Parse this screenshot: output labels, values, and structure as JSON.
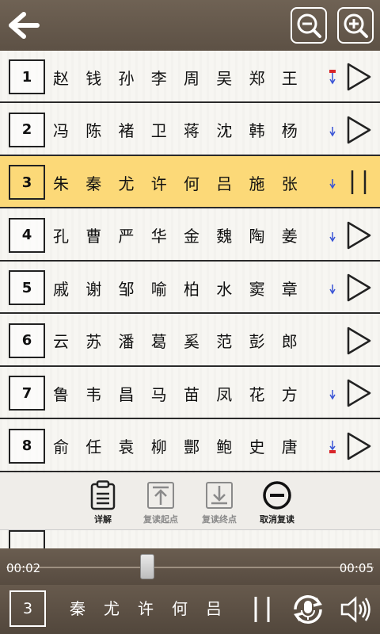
{
  "toolbar": {
    "back_icon": "back-arrow-icon",
    "zoom_out_icon": "zoom-out-icon",
    "zoom_in_icon": "zoom-in-icon"
  },
  "rows": [
    {
      "num": "1",
      "names": [
        "赵",
        "钱",
        "孙",
        "李",
        "周",
        "吴",
        "郑",
        "王"
      ],
      "indicator": "down-arrow-red",
      "state": "play"
    },
    {
      "num": "2",
      "names": [
        "冯",
        "陈",
        "褚",
        "卫",
        "蒋",
        "沈",
        "韩",
        "杨"
      ],
      "indicator": "down-arrow-blue",
      "state": "play"
    },
    {
      "num": "3",
      "names": [
        "朱",
        "秦",
        "尤",
        "许",
        "何",
        "吕",
        "施",
        "张"
      ],
      "indicator": "down-arrow-blue",
      "state": "pause"
    },
    {
      "num": "4",
      "names": [
        "孔",
        "曹",
        "严",
        "华",
        "金",
        "魏",
        "陶",
        "姜"
      ],
      "indicator": "down-arrow-blue",
      "state": "play"
    },
    {
      "num": "5",
      "names": [
        "戚",
        "谢",
        "邹",
        "喻",
        "柏",
        "水",
        "窦",
        "章"
      ],
      "indicator": "down-arrow-blue",
      "state": "play"
    },
    {
      "num": "6",
      "names": [
        "云",
        "苏",
        "潘",
        "葛",
        "奚",
        "范",
        "彭",
        "郎"
      ],
      "indicator": "none",
      "state": "play"
    },
    {
      "num": "7",
      "names": [
        "鲁",
        "韦",
        "昌",
        "马",
        "苗",
        "凤",
        "花",
        "方"
      ],
      "indicator": "down-arrow-blue",
      "state": "play"
    },
    {
      "num": "8",
      "names": [
        "俞",
        "任",
        "袁",
        "柳",
        "酆",
        "鲍",
        "史",
        "唐"
      ],
      "indicator": "down-arrow-red-end",
      "state": "play"
    }
  ],
  "popup": {
    "details_label": "详解",
    "repeat_start_label": "复读起点",
    "repeat_end_label": "复读终点",
    "cancel_repeat_label": "取消复读"
  },
  "player": {
    "current_time": "00:02",
    "total_time": "00:05",
    "progress": 0.38
  },
  "bottom": {
    "current_num": "3",
    "current_names": [
      "秦",
      "尤",
      "许",
      "何",
      "吕"
    ]
  },
  "colors": {
    "active_row": "#fcd978",
    "bar_brown": "#5d5145",
    "indicator_blue": "#3a55d6",
    "indicator_red": "#d9262a"
  }
}
